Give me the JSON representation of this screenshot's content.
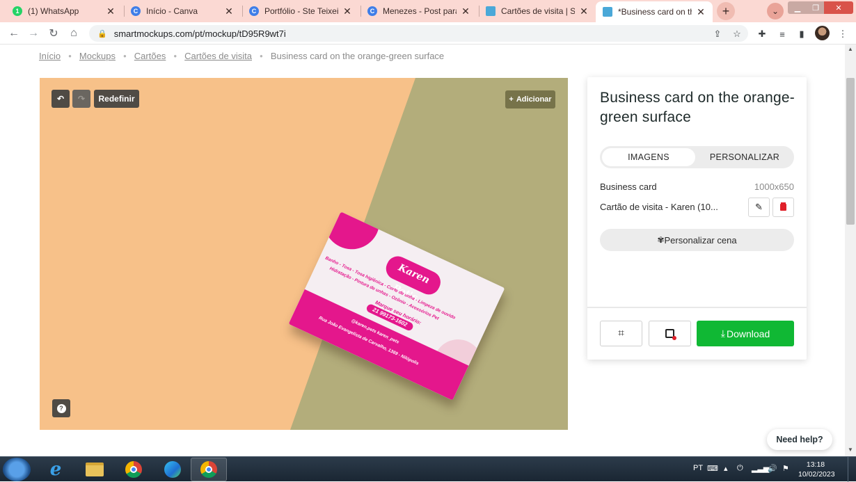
{
  "browser": {
    "tabs": [
      {
        "title": "(1) WhatsApp",
        "favicon": "whatsapp-icon",
        "color": "#25d366",
        "glyph": "1"
      },
      {
        "title": "Início - Canva",
        "favicon": "canva-icon",
        "color": "#3f7ee8",
        "glyph": "C"
      },
      {
        "title": "Portfólio - Ste Teixeira D",
        "favicon": "canva-icon",
        "color": "#3f7ee8",
        "glyph": "C"
      },
      {
        "title": "Menezes - Post para Fa",
        "favicon": "canva-icon",
        "color": "#3f7ee8",
        "glyph": "C"
      },
      {
        "title": "Cartões de visita | Sma",
        "favicon": "smartmockups-icon",
        "color": "#4aa8d8",
        "glyph": ""
      },
      {
        "title": "*Business card on the o",
        "favicon": "smartmockups-icon",
        "color": "#4aa8d8",
        "glyph": ""
      }
    ],
    "url": "smartmockups.com/pt/mockup/tD95R9wt7i"
  },
  "breadcrumb": {
    "items": [
      "Início",
      "Mockups",
      "Cartões",
      "Cartões de visita"
    ],
    "current": "Business card on the orange-green surface"
  },
  "editor": {
    "reset_label": "Redefinir",
    "add_label": "Adicionar",
    "help_glyph": "?"
  },
  "card": {
    "brand": "Karen Pet's",
    "services_1": "Banho - Tosa - Tosa higiênica - Corte de unha - Limpeza de ouvido",
    "services_2": "Hidratação - Pintura de unhas - Ozônio - Acessórios Pet",
    "schedule": "Marque seu horário:",
    "phone": "21 99173-1602",
    "social": "@karen.pets   karen_pets",
    "address": "Rua João Evangelista de Carvalho, 1369 - Nilópolis"
  },
  "panel": {
    "title": "Business card on the orange-green surface",
    "tabs": {
      "images": "IMAGENS",
      "customize": "PERSONALIZAR"
    },
    "item_label": "Business card",
    "item_size": "1000x650",
    "layer_label": "Cartão de visita - Karen (10...",
    "scene_label": "Personalizar cena",
    "download_label": "Download",
    "accent": "#10b834"
  },
  "help": {
    "label": "Need help?"
  },
  "taskbar": {
    "lang": "PT",
    "time": "13:18",
    "date": "10/02/2023"
  }
}
